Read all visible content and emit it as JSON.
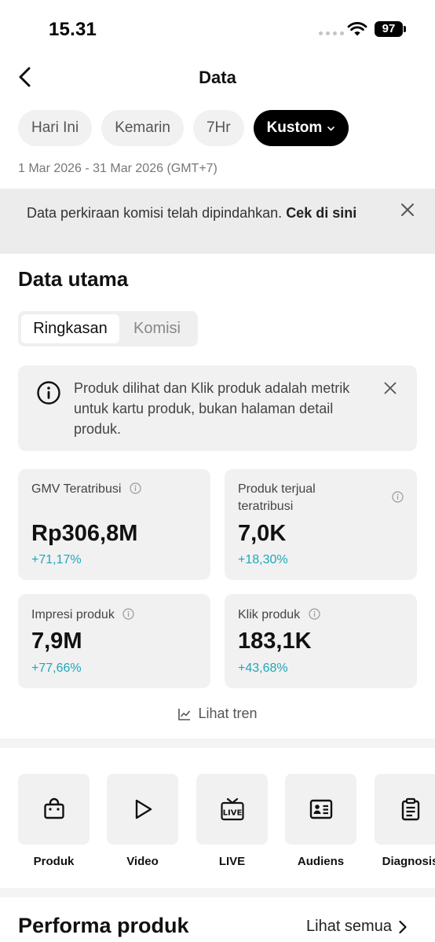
{
  "status_bar": {
    "time": "15.31",
    "battery": "97"
  },
  "nav": {
    "title": "Data"
  },
  "filters": {
    "chips": [
      {
        "label": "Hari Ini",
        "active": false
      },
      {
        "label": "Kemarin",
        "active": false
      },
      {
        "label": "7Hr",
        "active": false
      },
      {
        "label": "Kustom",
        "active": true
      }
    ],
    "date_range": "1 Mar 2026 - 31 Mar 2026 (GMT+7)"
  },
  "notice": {
    "text": "Data perkiraan komisi telah dipindahkan. ",
    "link": "Cek di sini"
  },
  "main": {
    "title": "Data utama",
    "tabs": [
      "Ringkasan",
      "Komisi"
    ],
    "active_tab": "Ringkasan",
    "info": "Produk dilihat dan Klik produk adalah metrik untuk kartu produk, bukan halaman detail produk.",
    "metrics": [
      {
        "label": "GMV Teratribusi",
        "value": "Rp306,8M",
        "change": "+71,17%"
      },
      {
        "label": "Produk terjual teratribusi",
        "value": "7,0K",
        "change": "+18,30%"
      },
      {
        "label": "Impresi produk",
        "value": "7,9M",
        "change": "+77,66%"
      },
      {
        "label": "Klik produk",
        "value": "183,1K",
        "change": "+43,68%"
      }
    ],
    "trend_link": "Lihat tren"
  },
  "shortcuts": [
    {
      "label": "Produk",
      "icon": "shopping-bag-icon"
    },
    {
      "label": "Video",
      "icon": "play-icon"
    },
    {
      "label": "LIVE",
      "icon": "live-icon"
    },
    {
      "label": "Audiens",
      "icon": "id-card-icon"
    },
    {
      "label": "Diagnosis",
      "icon": "clipboard-icon"
    }
  ],
  "performance": {
    "title": "Performa produk",
    "see_all": "Lihat semua"
  },
  "colors": {
    "accent_positive": "#1ea7b7",
    "chip_active_bg": "#000000",
    "card_bg": "#f1f1f2"
  }
}
